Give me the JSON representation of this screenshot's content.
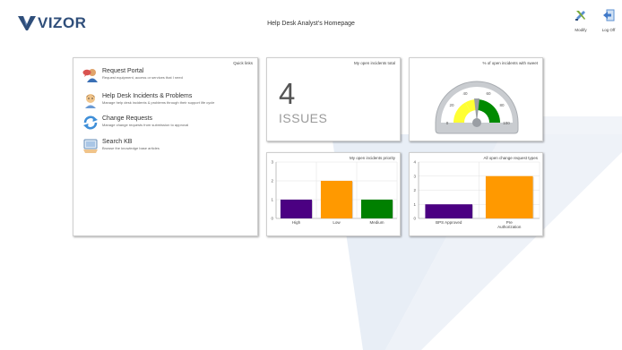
{
  "brand": {
    "name": "VIZOR",
    "color": "#2f4e7a"
  },
  "header": {
    "title": "Help Desk Analyst's Homepage"
  },
  "toolbar": {
    "modify_label": "Modify",
    "logoff_label": "Log Off"
  },
  "quick_links": {
    "title": "Quick links",
    "items": [
      {
        "name": "Request Portal",
        "description": "Request equipment, access or services that I need",
        "icon": "request-portal-icon"
      },
      {
        "name": "Help Desk Incidents & Problems",
        "description": "Manage help desk incidents & problems through their support life cycle",
        "icon": "help-desk-agent-icon"
      },
      {
        "name": "Change Requests",
        "description": "Manage change requests from submission to approval",
        "icon": "change-requests-icon"
      },
      {
        "name": "Search KB",
        "description": "Browse the knowledge base articles",
        "icon": "search-kb-icon"
      }
    ]
  },
  "open_incidents_total": {
    "title": "My open incidents total",
    "count": "4",
    "unit_label": "ISSUES"
  },
  "sla_gauge": {
    "title": "% of open incidents with sweet",
    "ticks": [
      "0",
      "20",
      "40",
      "60",
      "80",
      "100"
    ]
  },
  "chart_data": [
    {
      "type": "bar",
      "title": "My open incidents priority",
      "categories": [
        "High",
        "Low",
        "Medium"
      ],
      "values": [
        1,
        2,
        1
      ],
      "colors": [
        "#4b0082",
        "#ff9900",
        "#008000"
      ],
      "ylim": [
        0,
        3
      ],
      "yticks": [
        "0",
        "1",
        "2",
        "3"
      ],
      "grid": true
    },
    {
      "type": "bar",
      "title": "All open change request types",
      "categories": [
        "BPS Approved",
        "Pre Authorization"
      ],
      "values": [
        1,
        3
      ],
      "colors": [
        "#4b0082",
        "#ff9900"
      ],
      "ylim": [
        0,
        4
      ],
      "yticks": [
        "0",
        "1",
        "2",
        "3",
        "4"
      ],
      "grid": true
    }
  ]
}
